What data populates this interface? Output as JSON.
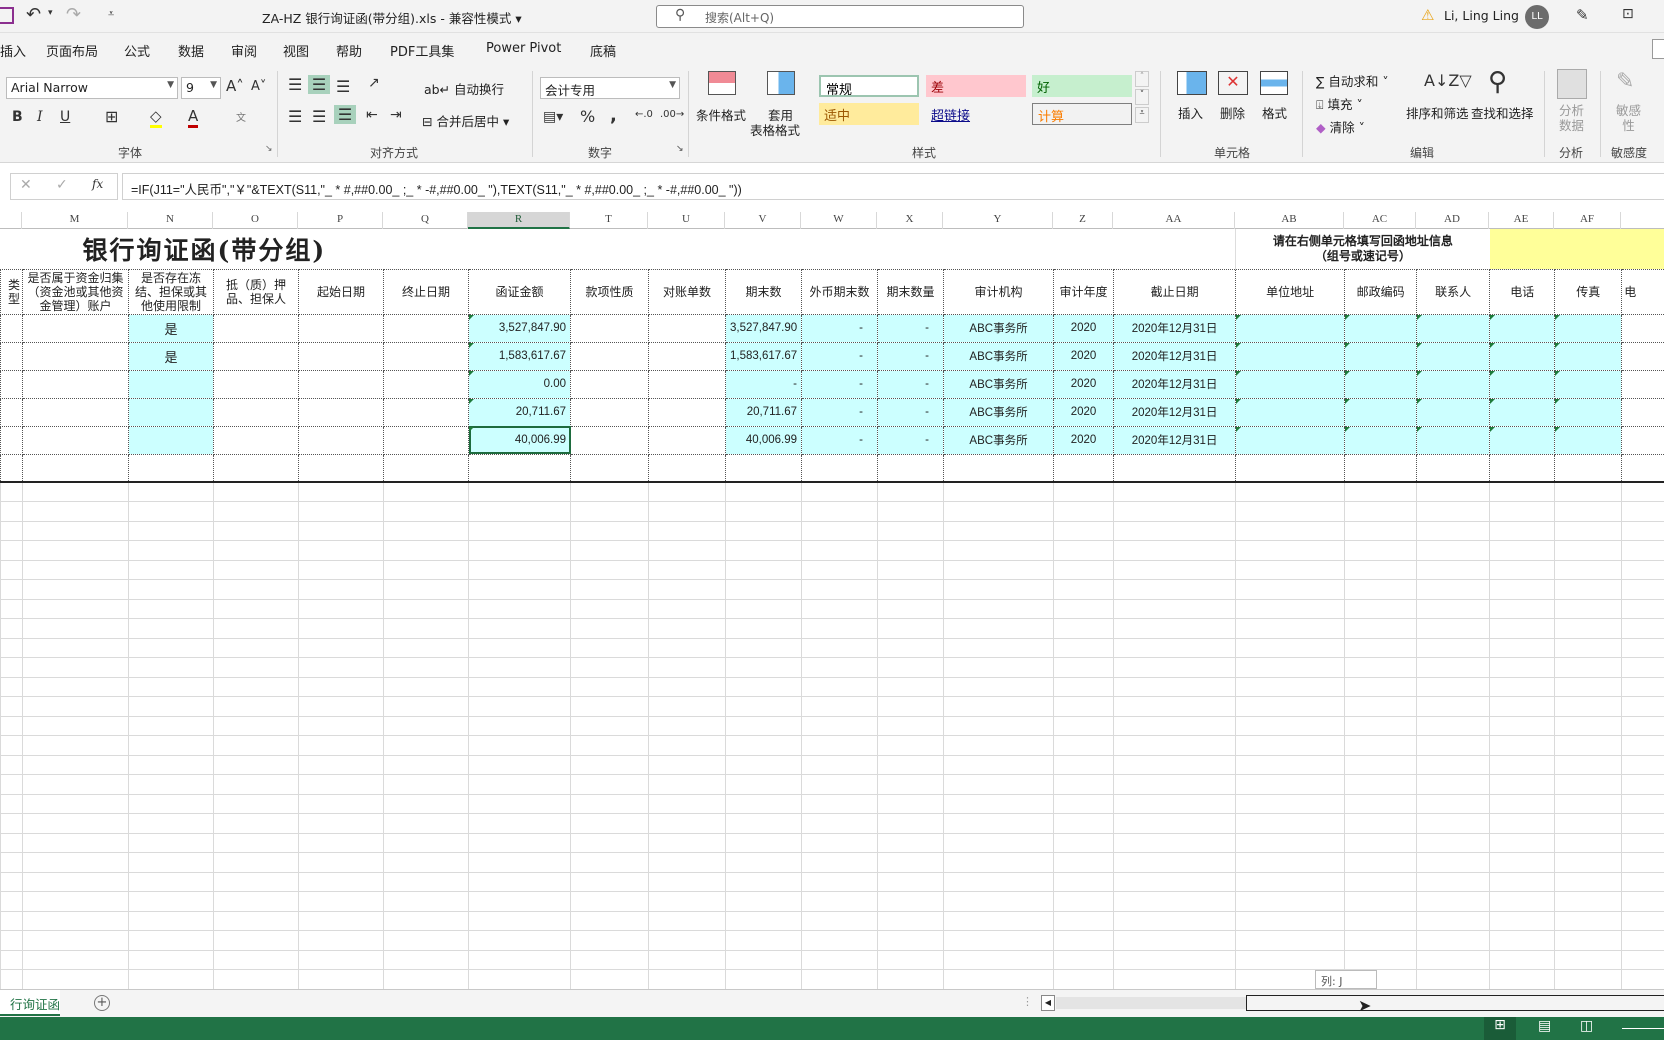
{
  "titlebar": {
    "doc_title": "ZA-HZ 银行询证函(带分组).xls  -  兼容性模式 ▾",
    "search_placeholder": "搜索(Alt+Q)",
    "user_name": "Li, Ling Ling",
    "avatar_initials": "LL"
  },
  "menu": [
    "插入",
    "页面布局",
    "公式",
    "数据",
    "审阅",
    "视图",
    "帮助",
    "PDF工具集",
    "Power Pivot",
    "底稿"
  ],
  "ribbon": {
    "font": {
      "name": "Arial Narrow",
      "size": "9",
      "label": "字体"
    },
    "alignment": {
      "wrap": "自动换行",
      "merge": "合并后居中",
      "label": "对齐方式"
    },
    "number": {
      "format": "会计专用",
      "label": "数字"
    },
    "styles": {
      "conditional": "条件格式",
      "table_format_1": "套用",
      "table_format_2": "表格格式",
      "items": [
        {
          "text": "常规",
          "bg": "#ffffff",
          "fg": "#000000"
        },
        {
          "text": "差",
          "bg": "#ffc7ce",
          "fg": "#9c0006"
        },
        {
          "text": "好",
          "bg": "#c6efce",
          "fg": "#006100"
        },
        {
          "text": "适中",
          "bg": "#ffeb9c",
          "fg": "#9c5700"
        },
        {
          "text": "超链接",
          "bg": "#f3f3f3",
          "fg": "#0b0b8a"
        },
        {
          "text": "计算",
          "bg": "#f2f2f2",
          "fg": "#fa7d00"
        }
      ],
      "label": "样式"
    },
    "cells": {
      "insert": "插入",
      "delete": "删除",
      "format": "格式",
      "label": "单元格"
    },
    "editing": {
      "autosum": "自动求和",
      "fill": "填充",
      "clear": "清除",
      "sort": "排序和筛选",
      "find": "查找和选择",
      "label": "编辑"
    },
    "analysis": {
      "button_1": "分析",
      "button_2": "数据",
      "label": "分析"
    },
    "sensitivity": {
      "button_1": "敏感",
      "button_2": "性",
      "label": "敏感度"
    }
  },
  "formula_bar": {
    "fx": "fx",
    "formula": "=IF(J11=\"人民币\",\"￥\"&TEXT(S11,\"_ * #,##0.00_ ;_ * -#,##0.00_ \"),TEXT(S11,\"_ * #,##0.00_ ;_ * -#,##0.00_ \"))"
  },
  "columns": [
    "",
    "M",
    "N",
    "O",
    "P",
    "Q",
    "R",
    "T",
    "U",
    "V",
    "W",
    "X",
    "Y",
    "Z",
    "AA",
    "AB",
    "AC",
    "AD",
    "AE",
    "AF",
    ""
  ],
  "selected_column": "R",
  "sheet": {
    "title": "银行询证函(带分组)",
    "address_note_1": "请在右侧单元格填写回函地址信息",
    "address_note_2": "（组号或速记号）",
    "headers": [
      "类型",
      "是否属于资金归集（资金池或其他资金管理）账户",
      "是否存在冻结、担保或其他使用限制",
      "抵（质）押品、担保人",
      "起始日期",
      "终止日期",
      "函证金额",
      "款项性质",
      "对账单数",
      "期末数",
      "外币期末数",
      "期末数量",
      "审计机构",
      "审计年度",
      "截止日期",
      "单位地址",
      "邮政编码",
      "联系人",
      "电话",
      "传真",
      "电"
    ],
    "rows": [
      [
        "",
        "",
        "是",
        "",
        "",
        "",
        "3,527,847.90",
        "",
        "",
        "3,527,847.90",
        "-",
        "-",
        "ABC事务所",
        "2020",
        "2020年12月31日",
        "",
        "",
        "",
        "",
        "",
        ""
      ],
      [
        "",
        "",
        "是",
        "",
        "",
        "",
        "1,583,617.67",
        "",
        "",
        "1,583,617.67",
        "-",
        "-",
        "ABC事务所",
        "2020",
        "2020年12月31日",
        "",
        "",
        "",
        "",
        "",
        ""
      ],
      [
        "",
        "",
        "",
        "",
        "",
        "",
        "0.00",
        "",
        "",
        "-",
        "-",
        "-",
        "ABC事务所",
        "2020",
        "2020年12月31日",
        "",
        "",
        "",
        "",
        "",
        ""
      ],
      [
        "",
        "",
        "",
        "",
        "",
        "",
        "20,711.67",
        "",
        "",
        "20,711.67",
        "-",
        "-",
        "ABC事务所",
        "2020",
        "2020年12月31日",
        "",
        "",
        "",
        "",
        "",
        ""
      ],
      [
        "",
        "",
        "",
        "",
        "",
        "",
        "40,006.99",
        "",
        "",
        "40,006.99",
        "-",
        "-",
        "ABC事务所",
        "2020",
        "2020年12月31日",
        "",
        "",
        "",
        "",
        "",
        ""
      ]
    ],
    "highlight_color": "#ccffff",
    "note_color": "#ffff99"
  },
  "sheet_tabs": {
    "active": "行询证函",
    "add": "+"
  },
  "tooltip": "列: J",
  "accent": "#217346"
}
